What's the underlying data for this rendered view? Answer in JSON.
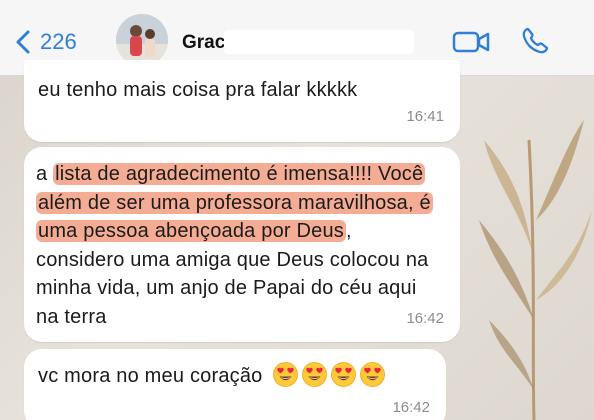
{
  "header": {
    "back_count": "226",
    "contact_name": "Graci"
  },
  "messages": [
    {
      "segments": [
        {
          "text": "eu tenho mais coisa pra falar kkkkk",
          "highlight": false
        }
      ],
      "time": "16:41"
    },
    {
      "segments": [
        {
          "text": "a ",
          "highlight": false
        },
        {
          "text": "lista de agradecimento é imensa!!!! Você além de ser uma professora maravilhosa, é uma pessoa abençoada por Deus",
          "highlight": true
        },
        {
          "text": ", considero uma amiga que Deus colocou na minha vida, um anjo de Papai do céu aqui na terra",
          "highlight": false
        }
      ],
      "time": "16:42"
    },
    {
      "segments": [
        {
          "text": "vc mora no meu coração",
          "highlight": false
        }
      ],
      "emoji": [
        "heart-eyes-emoji",
        "heart-eyes-emoji",
        "heart-eyes-emoji",
        "heart-eyes-emoji"
      ],
      "time": "16:42"
    }
  ],
  "colors": {
    "accent": "#2f7fd8",
    "highlight": "#f4ad94",
    "bubble": "#ffffff",
    "timestamp": "#8c8c8c",
    "header_bg": "#f6f6f6"
  },
  "icons": {
    "back": "chevron-left-icon",
    "video": "video-camera-icon",
    "call": "phone-icon"
  }
}
